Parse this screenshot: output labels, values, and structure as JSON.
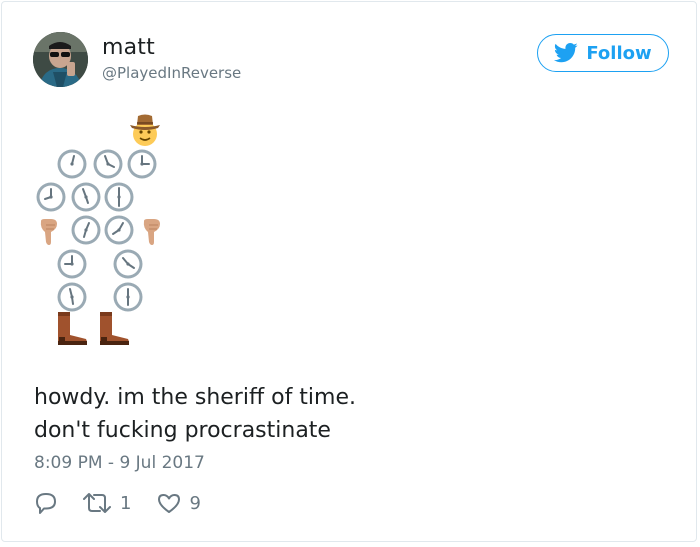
{
  "user": {
    "display_name": "matt",
    "handle": "@PlayedInReverse"
  },
  "follow_button": {
    "label": "Follow"
  },
  "tweet": {
    "text_line_1": "howdy. im the sheriff of time.",
    "text_line_2": "don't fucking procrastinate",
    "timestamp": "8:09 PM - 9 Jul 2017"
  },
  "actions": {
    "retweet_count": "1",
    "like_count": "9"
  },
  "icons": {
    "follow_icon": "bird-icon",
    "hat": "cowboy-face-icon",
    "clock": "clock-face-icon",
    "hand": "pointing-down-hand-icon",
    "boot": "cowboy-boot-icon",
    "reply": "reply-icon",
    "retweet": "retweet-icon",
    "like": "heart-icon"
  },
  "colors": {
    "accent": "#1da1f2",
    "text": "#1c2022",
    "muted": "#697882",
    "border": "#e1e8ed",
    "clock_ring": "#9aaab4",
    "boot": "#a0522d",
    "hand": "#d9a582"
  }
}
